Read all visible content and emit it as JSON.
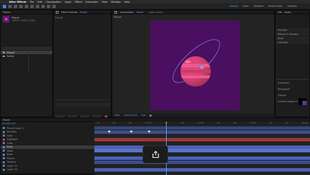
{
  "menu": {
    "apple": "",
    "items": [
      "After Effects",
      "File",
      "Edit",
      "Composition",
      "Layer",
      "Effect",
      "Animation",
      "View",
      "Window",
      "Help"
    ]
  },
  "toolbar": {
    "workspaces": [
      "Default",
      "Learn",
      "Standard",
      "Small Screen",
      "Libraries"
    ],
    "selected_workspace": "Default"
  },
  "project": {
    "tab": "Project",
    "comp_name": "Planet",
    "comp_info": "1080 x 1920 (1.00)",
    "search_placeholder": "",
    "items": [
      "Planet",
      "Solids"
    ]
  },
  "effect_controls": {
    "tab": "Effect Controls",
    "label": "Planet"
  },
  "composition": {
    "tab": "Composition",
    "name": "Planet",
    "layer_tab": "Layer (none)",
    "footer_zoom": "50%",
    "footer_time": "0;00;01;29",
    "footer_res": "Full"
  },
  "info_panel": {
    "tabs": [
      "Info",
      "Audio"
    ],
    "items": [
      "Preview",
      "Effects & Presets",
      "Align",
      "Libraries",
      "Character",
      "Paragraph",
      "Tracker",
      "Content-Aware Fill"
    ]
  },
  "properties": {
    "labels": [
      "Align",
      "Paragraph",
      "Character",
      "Opacity"
    ]
  },
  "timeline": {
    "tab": "Planet",
    "time": "0;00;01;29",
    "layers": [
      "Planet Layer 2",
      "Shadow",
      "Dark",
      "Highlight",
      "Orbit",
      "Ring",
      "Moon",
      "Base",
      "Planet",
      "Texture",
      "Layer 11",
      "Layer 12"
    ],
    "ruler": [
      "0f",
      "10f",
      "20f",
      "01:00f",
      "10f",
      "20f",
      "02:00f",
      "10f",
      "20f",
      "03:00f",
      "10f",
      "20f",
      "04:00f"
    ]
  },
  "overlay": {
    "icon": "share-icon"
  },
  "colors": {
    "planet": "#e0457a",
    "background": "#4a0f5e",
    "accent": "#2d8ceb"
  }
}
